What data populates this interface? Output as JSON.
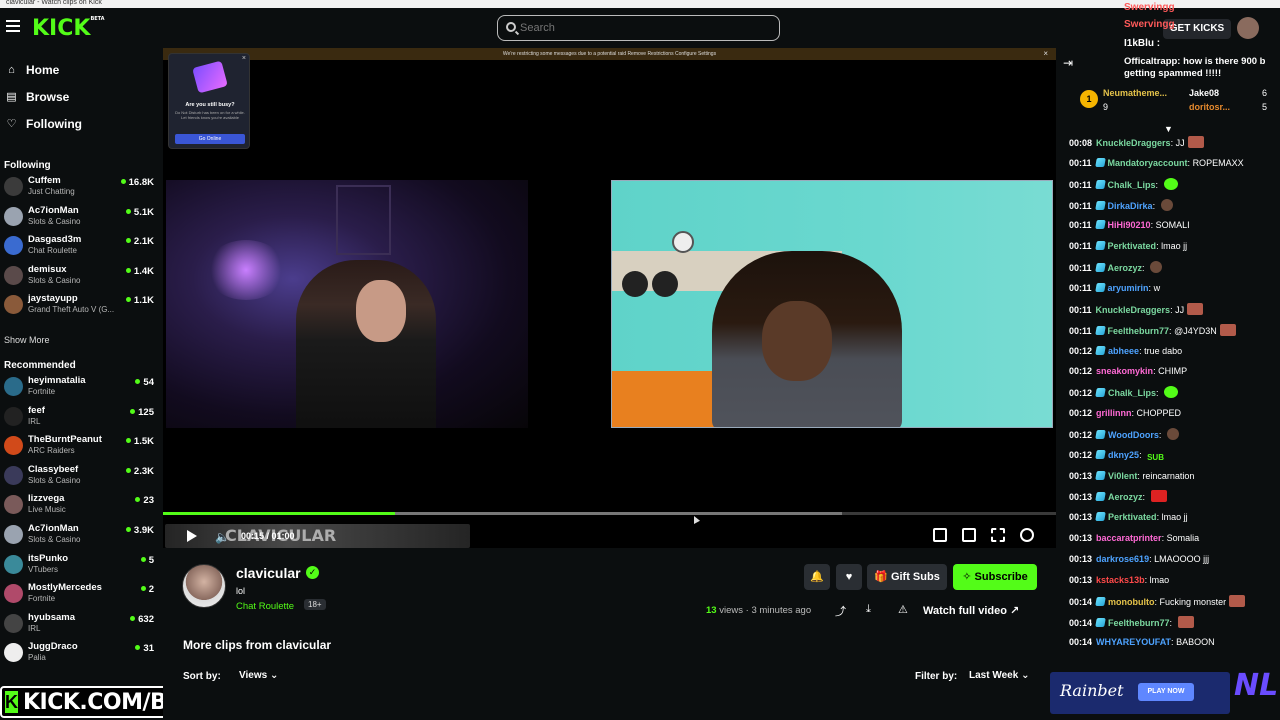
{
  "browser": {
    "tab_title": "clavicular - Watch clips on Kick"
  },
  "topbar": {
    "logo": "KICK",
    "logo_beta": "BETA",
    "search_placeholder": "Search",
    "get_kicks": "GET KICKS"
  },
  "nav": {
    "home": "Home",
    "browse": "Browse",
    "following": "Following"
  },
  "following": {
    "title": "Following",
    "items": [
      {
        "name": "Cuffem",
        "category": "Just Chatting",
        "viewers": "16.8K",
        "color": "#3b3b3b"
      },
      {
        "name": "Ac7ionMan",
        "category": "Slots & Casino",
        "viewers": "5.1K",
        "color": "#9aa3b0"
      },
      {
        "name": "Dasgasd3m",
        "category": "Chat Roulette",
        "viewers": "2.1K",
        "color": "#3a6bd0"
      },
      {
        "name": "demisux",
        "category": "Slots & Casino",
        "viewers": "1.4K",
        "color": "#5a4a4a"
      },
      {
        "name": "jaystayupp",
        "category": "Grand Theft Auto V (G...",
        "viewers": "1.1K",
        "color": "#8a5a3a"
      }
    ],
    "show_more": "Show More"
  },
  "recommended": {
    "title": "Recommended",
    "items": [
      {
        "name": "heyimnatalia",
        "category": "Fortnite",
        "viewers": "54",
        "color": "#2a6b8a"
      },
      {
        "name": "feef",
        "category": "IRL",
        "viewers": "125",
        "color": "#222"
      },
      {
        "name": "TheBurntPeanut",
        "category": "ARC Raiders",
        "viewers": "1.5K",
        "color": "#d14a1a"
      },
      {
        "name": "Classybeef",
        "category": "Slots & Casino",
        "viewers": "2.3K",
        "color": "#3a3a5a"
      },
      {
        "name": "lizzvega",
        "category": "Live Music",
        "viewers": "23",
        "color": "#7a5a5a"
      },
      {
        "name": "Ac7ionMan",
        "category": "Slots & Casino",
        "viewers": "3.9K",
        "color": "#9aa3b0"
      },
      {
        "name": "itsPunko",
        "category": "VTubers",
        "viewers": "5",
        "color": "#3a8a9a"
      },
      {
        "name": "MostlyMercedes",
        "category": "Fortnite",
        "viewers": "2",
        "color": "#b04a6a"
      },
      {
        "name": "hyubsama",
        "category": "IRL",
        "viewers": "632",
        "color": "#444"
      },
      {
        "name": "JuggDraco",
        "category": "Palia",
        "viewers": "31",
        "color": "#eee"
      }
    ]
  },
  "watermark": "KICK.COM/BALLER",
  "player": {
    "notice": "We're restricting some messages due to a potential raid   Remove Restrictions   Configure Settings",
    "busy_title": "Are you still busy?",
    "busy_desc": "Do Not Disturb has been on for a while. Let friends know you're available",
    "busy_button": "Go Online",
    "overlay_text": "CLAVICULAR",
    "time": "00:15 / 01:00",
    "progress_fraction": 0.26,
    "buffered_fraction": 0.76
  },
  "channel": {
    "name": "clavicular",
    "title": "lol",
    "category": "Chat Roulette",
    "badge": "18+",
    "gift_subs": "Gift Subs",
    "subscribe": "Subscribe",
    "views_count": "13",
    "views_label": "views",
    "time_ago": "3 minutes ago",
    "watch_full": "Watch full video"
  },
  "clips": {
    "heading": "More clips from clavicular",
    "sort_label": "Sort by:",
    "sort_value": "Views",
    "filter_label": "Filter by:",
    "filter_value": "Last Week"
  },
  "chat": {
    "overlay": {
      "line1": "Swervingg",
      "line2": "Swervingg",
      "line3": "I1kBlu :",
      "line4": "Officaltrapp: how is there 900 b getting spammed !!!!!"
    },
    "pinned": {
      "user1": "Neumatheme...",
      "count1": "9",
      "user2": "Jake08",
      "user2b": "doritosr...",
      "count2": "6",
      "count3": "5"
    },
    "messages": [
      {
        "time": "00:08",
        "user": "KnuckleDraggers",
        "color": "#7bd8a0",
        "badge": false,
        "text": "JJ",
        "emote": "plain"
      },
      {
        "time": "00:11",
        "user": "Mandatoryaccount",
        "color": "#7bd8a0",
        "badge": true,
        "text": "ROPEMAXX",
        "emote": ""
      },
      {
        "time": "00:11",
        "user": "Chalk_Lips",
        "color": "#7bd8a0",
        "badge": true,
        "text": "",
        "emote": "green"
      },
      {
        "time": "00:11",
        "user": "DirkaDirka",
        "color": "#4ea3ff",
        "badge": true,
        "text": "",
        "emote": "face"
      },
      {
        "time": "00:11",
        "user": "HiHi90210",
        "color": "#ff6ad5",
        "badge": true,
        "text": "SOMALI",
        "emote": ""
      },
      {
        "time": "00:11",
        "user": "Perktivated",
        "color": "#7bd8a0",
        "badge": true,
        "text": "lmao jj",
        "emote": ""
      },
      {
        "time": "00:11",
        "user": "Aerozyz",
        "color": "#7bd8a0",
        "badge": true,
        "text": "",
        "emote": "face"
      },
      {
        "time": "00:11",
        "user": "aryumirin",
        "color": "#4ea3ff",
        "badge": true,
        "text": "w",
        "emote": ""
      },
      {
        "time": "00:11",
        "user": "KnuckleDraggers",
        "color": "#7bd8a0",
        "badge": false,
        "text": "JJ",
        "emote": "plain"
      },
      {
        "time": "00:11",
        "user": "Feeltheburn77",
        "color": "#7bd8a0",
        "badge": true,
        "text": "@J4YD3N",
        "emote": "plain"
      },
      {
        "time": "00:12",
        "user": "abheee",
        "color": "#4ea3ff",
        "badge": true,
        "text": "true dabo",
        "emote": ""
      },
      {
        "time": "00:12",
        "user": "sneakomykin",
        "color": "#ff6ad5",
        "badge": false,
        "text": "CHIMP",
        "emote": ""
      },
      {
        "time": "00:12",
        "user": "Chalk_Lips",
        "color": "#7bd8a0",
        "badge": true,
        "text": "",
        "emote": "green"
      },
      {
        "time": "00:12",
        "user": "grillinnn",
        "color": "#ff6ad5",
        "badge": false,
        "text": "CHOPPED",
        "emote": ""
      },
      {
        "time": "00:12",
        "user": "WoodDoors",
        "color": "#4ea3ff",
        "badge": true,
        "text": "",
        "emote": "face"
      },
      {
        "time": "00:12",
        "user": "dkny25",
        "color": "#4ea3ff",
        "badge": true,
        "text": "",
        "emote": "sub"
      },
      {
        "time": "00:13",
        "user": "Vi0lent",
        "color": "#7bd8a0",
        "badge": true,
        "text": "reincarnation",
        "emote": ""
      },
      {
        "time": "00:13",
        "user": "Aerozyz",
        "color": "#7bd8a0",
        "badge": true,
        "text": "",
        "emote": "red"
      },
      {
        "time": "00:13",
        "user": "Perktivated",
        "color": "#7bd8a0",
        "badge": true,
        "text": "lmao jj",
        "emote": ""
      },
      {
        "time": "00:13",
        "user": "baccaratprinter",
        "color": "#ff6ad5",
        "badge": false,
        "text": "Somalia",
        "emote": ""
      },
      {
        "time": "00:13",
        "user": "darkrose619",
        "color": "#4ea3ff",
        "badge": false,
        "text": "LMAOOOO jjj",
        "emote": ""
      },
      {
        "time": "00:13",
        "user": "kstacks13b",
        "color": "#ff4a4a",
        "badge": false,
        "text": "lmao",
        "emote": ""
      },
      {
        "time": "00:14",
        "user": "monobulto",
        "color": "#e5c34a",
        "badge": true,
        "text": "Fucking monster",
        "emote": "plain"
      },
      {
        "time": "00:14",
        "user": "Feeltheburn77",
        "color": "#7bd8a0",
        "badge": true,
        "text": "",
        "emote": "plain"
      },
      {
        "time": "00:14",
        "user": "WHYAREYOUFAT",
        "color": "#4ea3ff",
        "badge": false,
        "text": "BABOON",
        "emote": ""
      }
    ],
    "ad": {
      "brand": "Rainbet",
      "cta": "PLAY NOW"
    },
    "corner_logo": "NL"
  }
}
